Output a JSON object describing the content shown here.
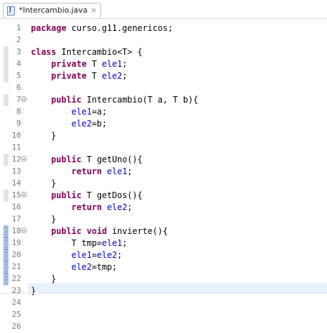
{
  "tab": {
    "title": "*Intercambio.java",
    "close_glyph": "×",
    "icon": "java-file-icon"
  },
  "editor": {
    "lines": [
      {
        "n": "1",
        "parts": [
          [
            "kw",
            "package"
          ],
          [
            "t",
            " curso.g11.genericos;"
          ]
        ]
      },
      {
        "n": "2",
        "parts": []
      },
      {
        "n": "3",
        "parts": [
          [
            "kw",
            "class"
          ],
          [
            "t",
            " Intercambio<T> {"
          ]
        ],
        "marker": "gray"
      },
      {
        "n": "4",
        "parts": [
          [
            "t",
            "    "
          ],
          [
            "kw",
            "private"
          ],
          [
            "t",
            " T "
          ],
          [
            "fld",
            "ele1"
          ],
          [
            "t",
            ";"
          ]
        ],
        "marker": "gray"
      },
      {
        "n": "5",
        "parts": [
          [
            "t",
            "    "
          ],
          [
            "kw",
            "private"
          ],
          [
            "t",
            " T "
          ],
          [
            "fld",
            "ele2"
          ],
          [
            "t",
            ";"
          ]
        ],
        "marker": "gray"
      },
      {
        "n": "6",
        "parts": []
      },
      {
        "n": "7",
        "fold": true,
        "parts": [
          [
            "t",
            "    "
          ],
          [
            "kw",
            "public"
          ],
          [
            "t",
            " Intercambio(T a, T b){"
          ]
        ],
        "marker": "gray"
      },
      {
        "n": "8",
        "parts": [
          [
            "t",
            "        "
          ],
          [
            "fld",
            "ele1"
          ],
          [
            "t",
            "=a;"
          ]
        ]
      },
      {
        "n": "9",
        "parts": [
          [
            "t",
            "        "
          ],
          [
            "fld",
            "ele2"
          ],
          [
            "t",
            "=b;"
          ]
        ]
      },
      {
        "n": "10",
        "parts": [
          [
            "t",
            "    }"
          ]
        ]
      },
      {
        "n": "11",
        "parts": []
      },
      {
        "n": "12",
        "fold": true,
        "parts": [
          [
            "t",
            "    "
          ],
          [
            "kw",
            "public"
          ],
          [
            "t",
            " T getUno(){"
          ]
        ],
        "marker": "gray"
      },
      {
        "n": "13",
        "parts": [
          [
            "t",
            "        "
          ],
          [
            "kw",
            "return"
          ],
          [
            "t",
            " "
          ],
          [
            "fld",
            "ele1"
          ],
          [
            "t",
            ";"
          ]
        ]
      },
      {
        "n": "14",
        "parts": [
          [
            "t",
            "    }"
          ]
        ]
      },
      {
        "n": "15",
        "fold": true,
        "parts": [
          [
            "t",
            "    "
          ],
          [
            "kw",
            "public"
          ],
          [
            "t",
            " T getDos(){"
          ]
        ],
        "marker": "gray"
      },
      {
        "n": "16",
        "parts": [
          [
            "t",
            "        "
          ],
          [
            "kw",
            "return"
          ],
          [
            "t",
            " "
          ],
          [
            "fld",
            "ele2"
          ],
          [
            "t",
            ";"
          ]
        ]
      },
      {
        "n": "17",
        "parts": [
          [
            "t",
            "    }"
          ]
        ]
      },
      {
        "n": "18",
        "fold": true,
        "parts": [
          [
            "t",
            "    "
          ],
          [
            "kw",
            "public"
          ],
          [
            "t",
            " "
          ],
          [
            "kw",
            "void"
          ],
          [
            "t",
            " invierte(){"
          ]
        ],
        "marker": "blue"
      },
      {
        "n": "19",
        "parts": [
          [
            "t",
            "        T tmp="
          ],
          [
            "fld",
            "ele1"
          ],
          [
            "t",
            ";"
          ]
        ],
        "marker": "blue"
      },
      {
        "n": "20",
        "parts": [
          [
            "t",
            "        "
          ],
          [
            "fld",
            "ele1"
          ],
          [
            "t",
            "="
          ],
          [
            "fld",
            "ele2"
          ],
          [
            "t",
            ";"
          ]
        ],
        "marker": "blue"
      },
      {
        "n": "21",
        "parts": [
          [
            "t",
            "        "
          ],
          [
            "fld",
            "ele2"
          ],
          [
            "t",
            "=tmp;"
          ]
        ],
        "marker": "blue"
      },
      {
        "n": "22",
        "parts": [
          [
            "t",
            "    }"
          ]
        ],
        "marker": "blue"
      },
      {
        "n": "23",
        "parts": [
          [
            "t",
            "}"
          ]
        ]
      },
      {
        "n": "24",
        "parts": []
      },
      {
        "n": "25",
        "parts": []
      },
      {
        "n": "26",
        "parts": []
      }
    ]
  }
}
